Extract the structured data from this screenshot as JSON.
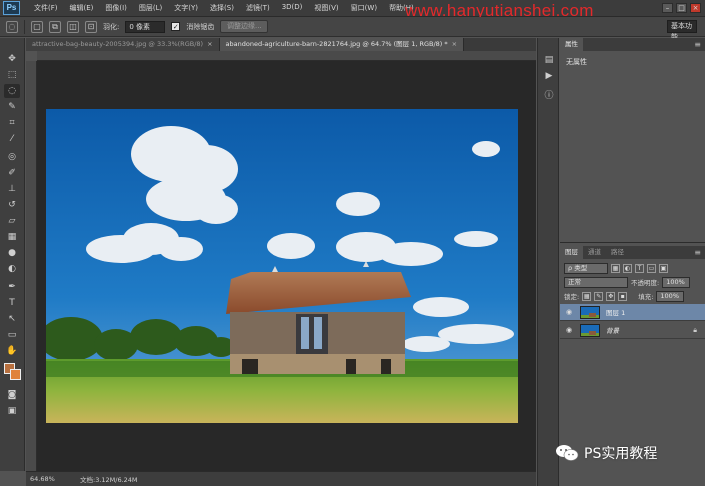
{
  "app": {
    "logo": "Ps"
  },
  "menu": [
    "文件(F)",
    "编辑(E)",
    "图像(I)",
    "图层(L)",
    "文字(Y)",
    "选择(S)",
    "滤镜(T)",
    "3D(D)",
    "视图(V)",
    "窗口(W)",
    "帮助(H)"
  ],
  "watermark": "www.hanyutianshei.com",
  "window_controls": {
    "minimize": "–",
    "restore": "□",
    "close": "×"
  },
  "options": {
    "feather_label": "羽化:",
    "feather_value": "0 像素",
    "antialias_label": "消除锯齿",
    "antialias_checked": "✓",
    "refine_edge": "调整边缘...",
    "workspace": "基本功能"
  },
  "tabs": [
    {
      "label": "attractive-bag-beauty-2005394.jpg @ 33.3%(RGB/8)",
      "close": "×"
    },
    {
      "label": "abandoned-agriculture-barn-2821764.jpg @ 64.7% (图层 1, RGB/8) *",
      "close": "×"
    }
  ],
  "status": {
    "zoom": "64.68%",
    "doc": "文档:3.12M/6.24M"
  },
  "properties": {
    "tab": "属性",
    "body": "无属性"
  },
  "layers_panel": {
    "tabs": [
      "图层",
      "通道",
      "路径"
    ],
    "kind_label": "ρ 类型",
    "blend_mode": "正常",
    "opacity_label": "不透明度:",
    "opacity_value": "100%",
    "lock_label": "锁定:",
    "fill_label": "填充:",
    "fill_value": "100%",
    "layers": [
      {
        "name": "图层 1",
        "selected": true
      },
      {
        "name": "背景",
        "selected": false
      }
    ]
  },
  "brand": "PS实用教程",
  "colors": {
    "foreground": "#b8703f",
    "background": "#e0833a",
    "selection": "#6d87a8",
    "accent": "#e3292b"
  }
}
